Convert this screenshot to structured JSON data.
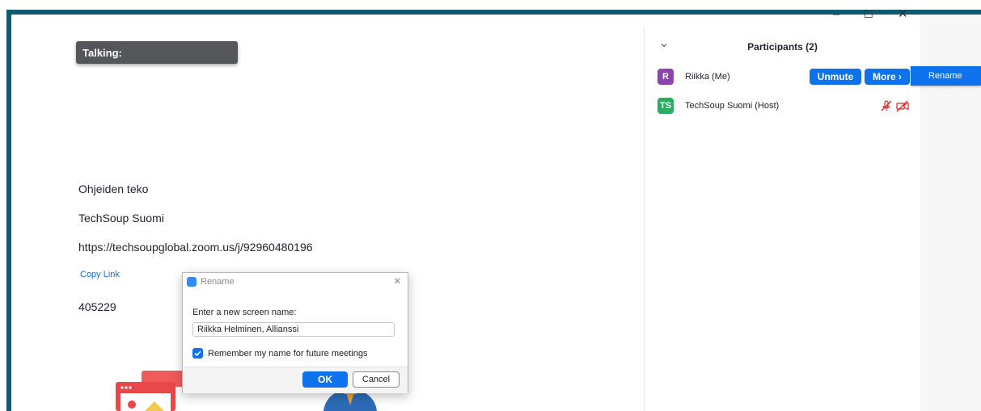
{
  "window": {
    "minimize_glyph": "–",
    "maximize_glyph": "☐",
    "close_glyph": "✕"
  },
  "meeting": {
    "talking_label": "Talking:",
    "topic": "Ohjeiden teko",
    "host_org": "TechSoup Suomi",
    "url": "https://techsoupglobal.zoom.us/j/92960480196",
    "copy_link_label": "Copy Link",
    "passcode": "405229"
  },
  "participants": {
    "title": "Participants (2)",
    "items": [
      {
        "initials": "R",
        "name": "Riikka (Me)",
        "avatar_color": "#8e44ad"
      },
      {
        "initials": "TS",
        "name": "TechSoup Suomi (Host)",
        "avatar_color": "#27ae60"
      }
    ],
    "unmute_label": "Unmute",
    "more_label": "More ›",
    "rename_menu_label": "Rename"
  },
  "rename_dialog": {
    "title": "Rename",
    "prompt": "Enter a new screen name:",
    "input_value": "Riikka Helminen, Allianssi",
    "remember_label": "Remember my name for future meetings",
    "remember_checked": true,
    "ok_label": "OK",
    "cancel_label": "Cancel"
  },
  "colors": {
    "accent": "#0e72ed",
    "frame": "#0e5a6e",
    "muted_red": "#e02828"
  }
}
